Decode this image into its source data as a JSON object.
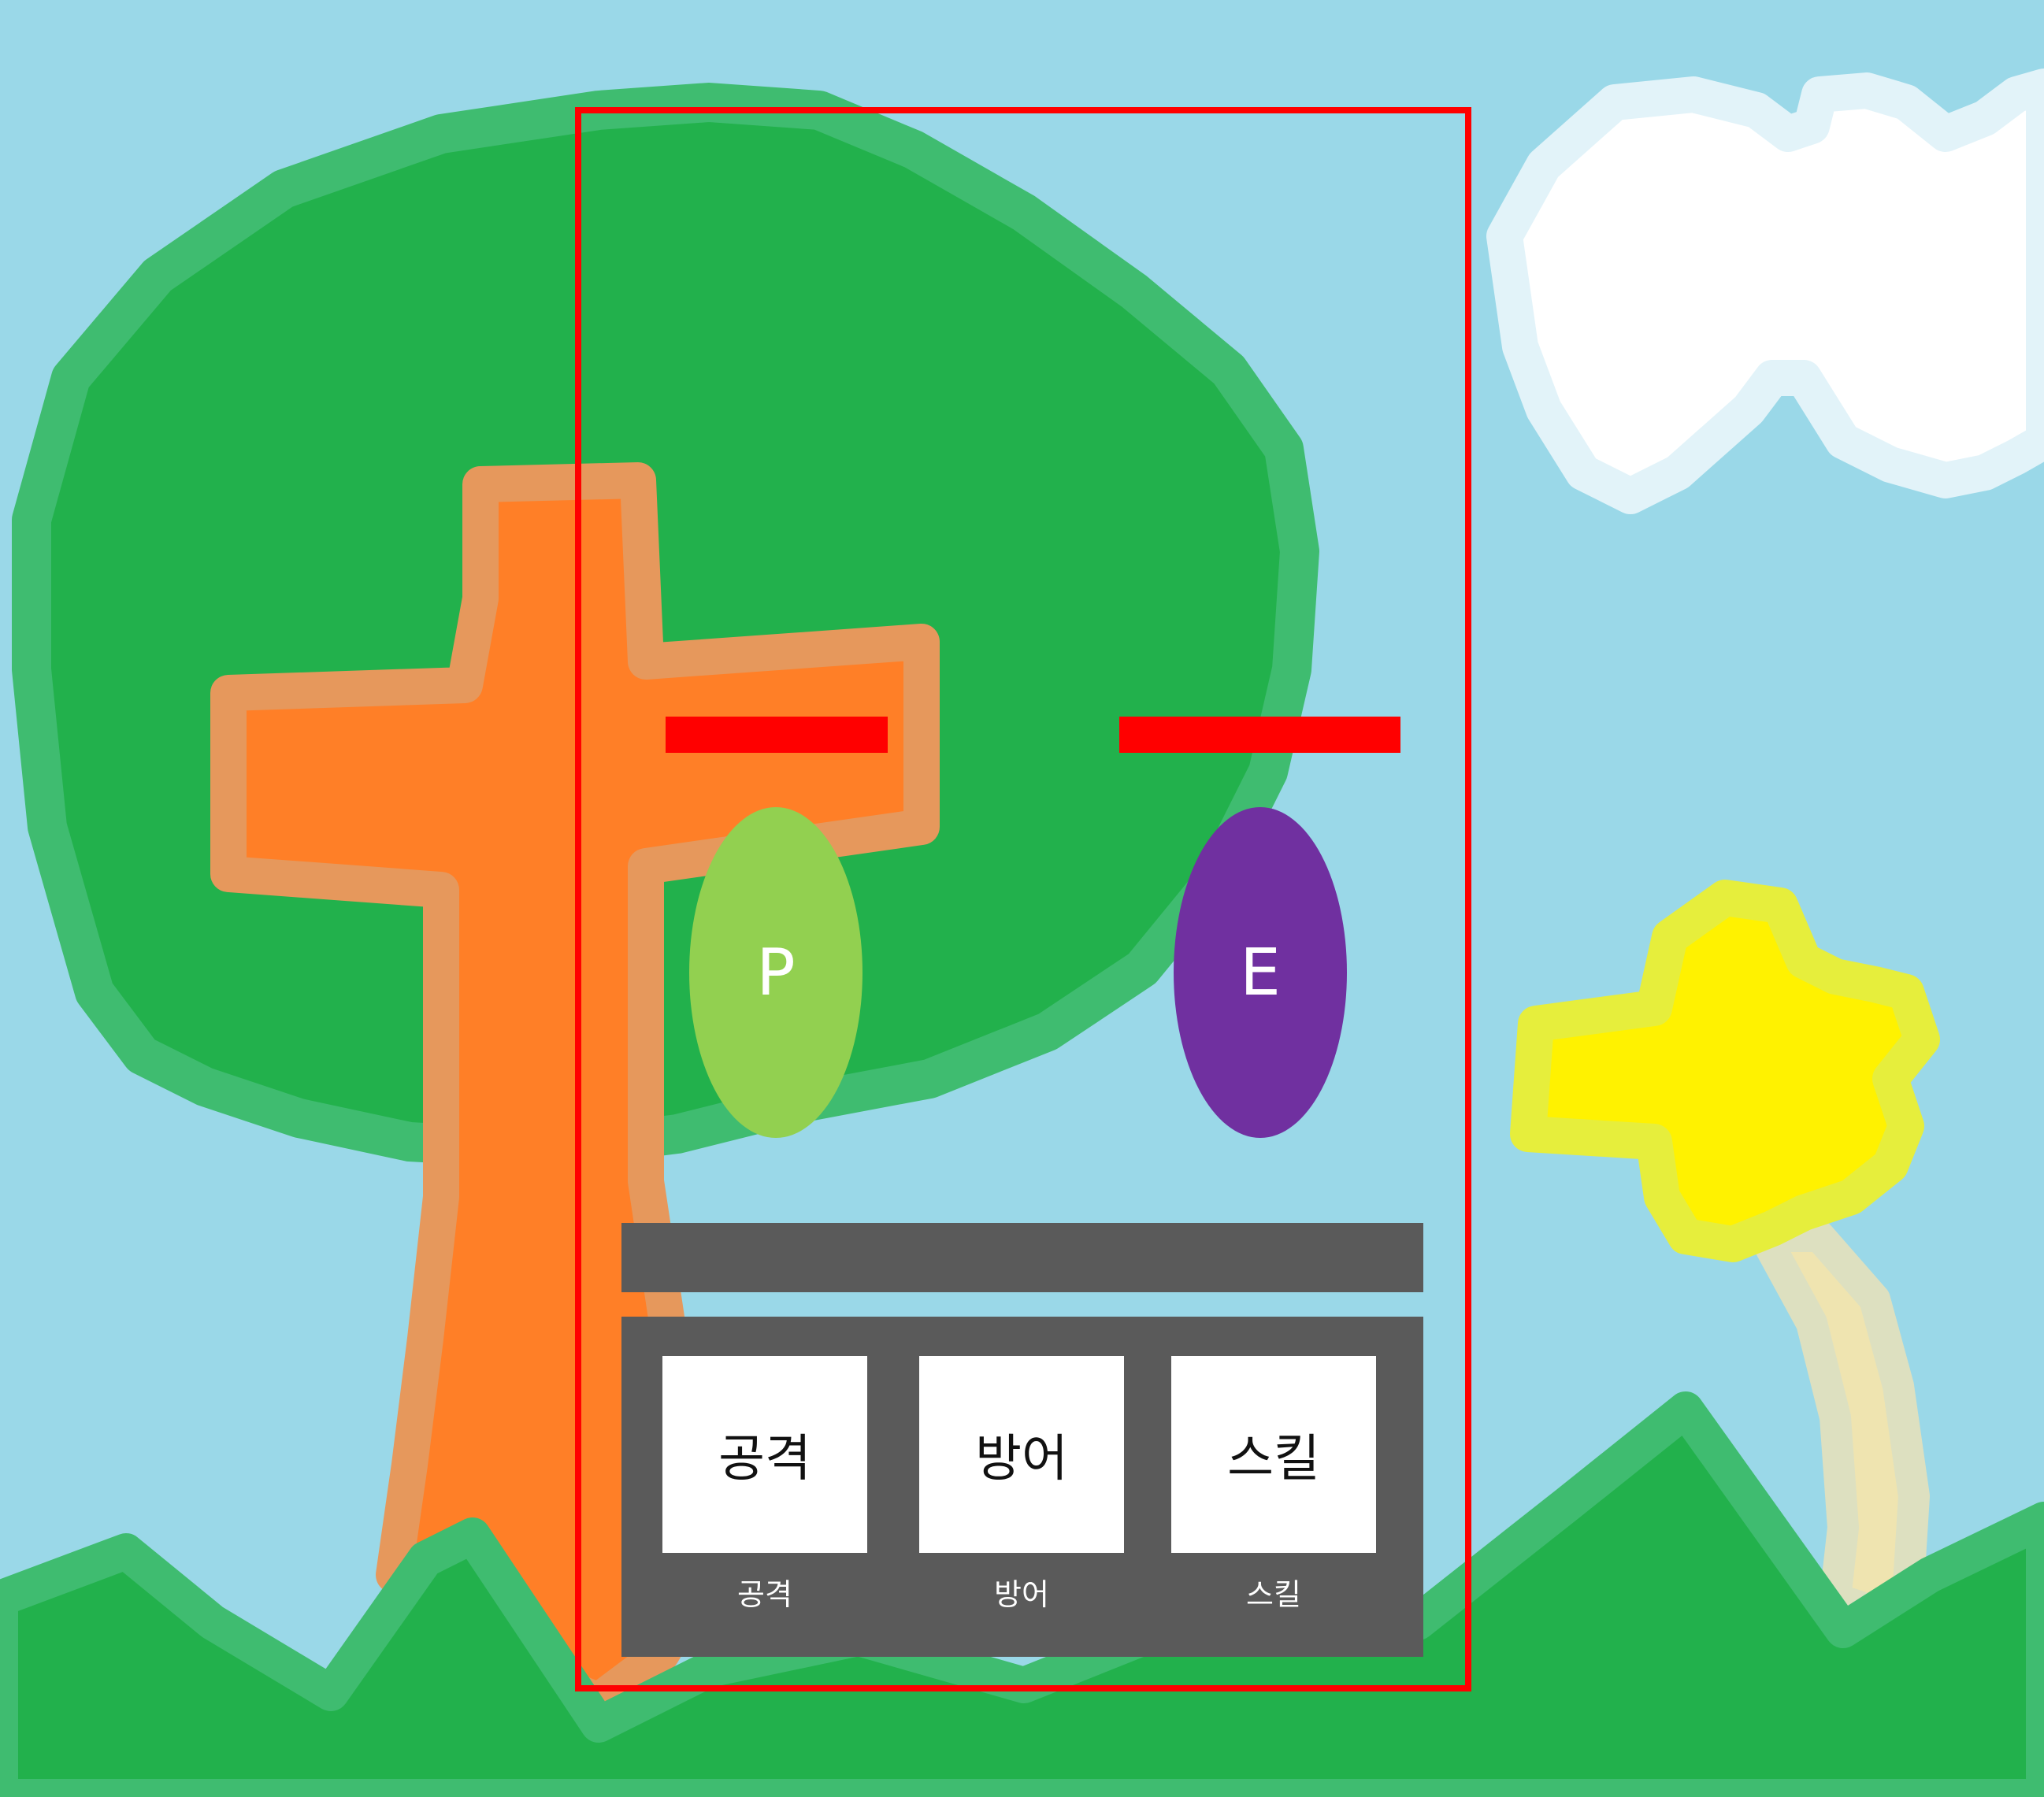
{
  "colors": {
    "sky": "#9ad8e8",
    "grass": "#22b14c",
    "grass_outline": "#3fbc70",
    "trunk": "#ff7f27",
    "trunk_outline": "#e6985c",
    "cloud": "#ffffff",
    "cloud_outline": "#e2f3f9",
    "flower": "#fff200",
    "flower_outline": "#e6ee3c",
    "stem": "#efe4b0",
    "hp_bar": "#ff0000",
    "player": "#92d050",
    "enemy": "#7030a0",
    "panel": "#5a5a5a",
    "button": "#ffffff",
    "viewport_frame": "#ff0000"
  },
  "player": {
    "label": "P",
    "hp": 1.0
  },
  "enemy": {
    "label": "E",
    "hp": 1.0
  },
  "message_bar": {
    "text": ""
  },
  "actions": [
    {
      "label": "공격",
      "caption": "공격"
    },
    {
      "label": "방어",
      "caption": "방어"
    },
    {
      "label": "스킬",
      "caption": "스킬"
    }
  ]
}
